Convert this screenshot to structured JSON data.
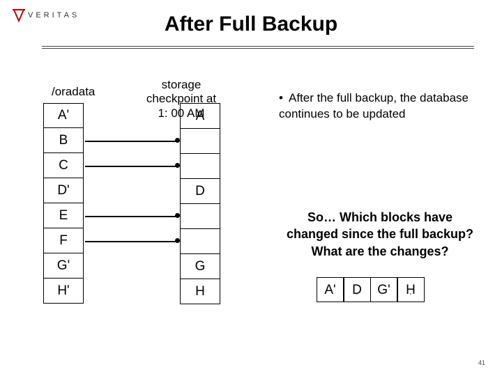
{
  "logo_text": "VERITAS",
  "title": "After Full Backup",
  "labels": {
    "oradata": "/oradata",
    "checkpoint_line1": "storage",
    "checkpoint_line2": "checkpoint at",
    "checkpoint_line3": "1: 00 AM"
  },
  "left_column": [
    "A'",
    "B",
    "C",
    "D'",
    "E",
    "F",
    "G'",
    "H'"
  ],
  "right_column": [
    "A",
    "",
    "",
    "D",
    "",
    "",
    "G",
    "H"
  ],
  "arrow_rows": [
    1,
    2,
    4,
    5
  ],
  "bullet": "After the full backup, the database continues to be updated",
  "question_line1": "So…  Which blocks have",
  "question_line2": "changed since the full backup?",
  "question_line3": "What are the changes?",
  "changed_blocks": [
    {
      "main": "A'",
      "sub": ""
    },
    {
      "main": "D",
      "sub": "'"
    },
    {
      "main": "G'",
      "sub": ""
    },
    {
      "main": "H",
      "sub": "'"
    }
  ],
  "page_number": "41"
}
